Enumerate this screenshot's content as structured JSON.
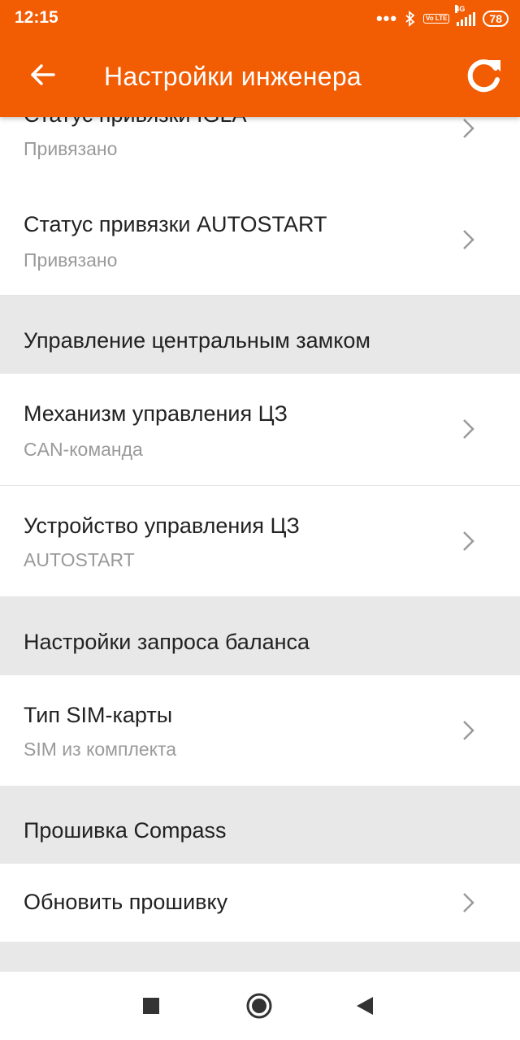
{
  "status_bar": {
    "time": "12:15",
    "network": "4G",
    "volte": "Vo LTE",
    "battery": "78"
  },
  "app_bar": {
    "title": "Настройки инженера",
    "back_icon": "arrow-left-icon",
    "refresh_icon": "refresh-icon"
  },
  "list": {
    "top_partial": {
      "title": "Статус привязки IGLA",
      "value": "Привязано"
    },
    "autostart_status": {
      "title": "Статус привязки AUTOSTART",
      "value": "Привязано"
    },
    "section_lock": "Управление центральным замком",
    "lock_mechanism": {
      "title": "Механизм управления ЦЗ",
      "value": "CAN-команда"
    },
    "lock_device": {
      "title": "Устройство управления ЦЗ",
      "value": "AUTOSTART"
    },
    "section_balance": "Настройки запроса баланса",
    "sim_type": {
      "title": "Тип SIM-карты",
      "value": "SIM из комплекта"
    },
    "section_firmware": "Прошивка Compass",
    "update_firmware": {
      "title": "Обновить прошивку"
    }
  },
  "colors": {
    "accent": "#f25c02",
    "section_bg": "#e8e8e8",
    "secondary_text": "#9a9a9a"
  }
}
